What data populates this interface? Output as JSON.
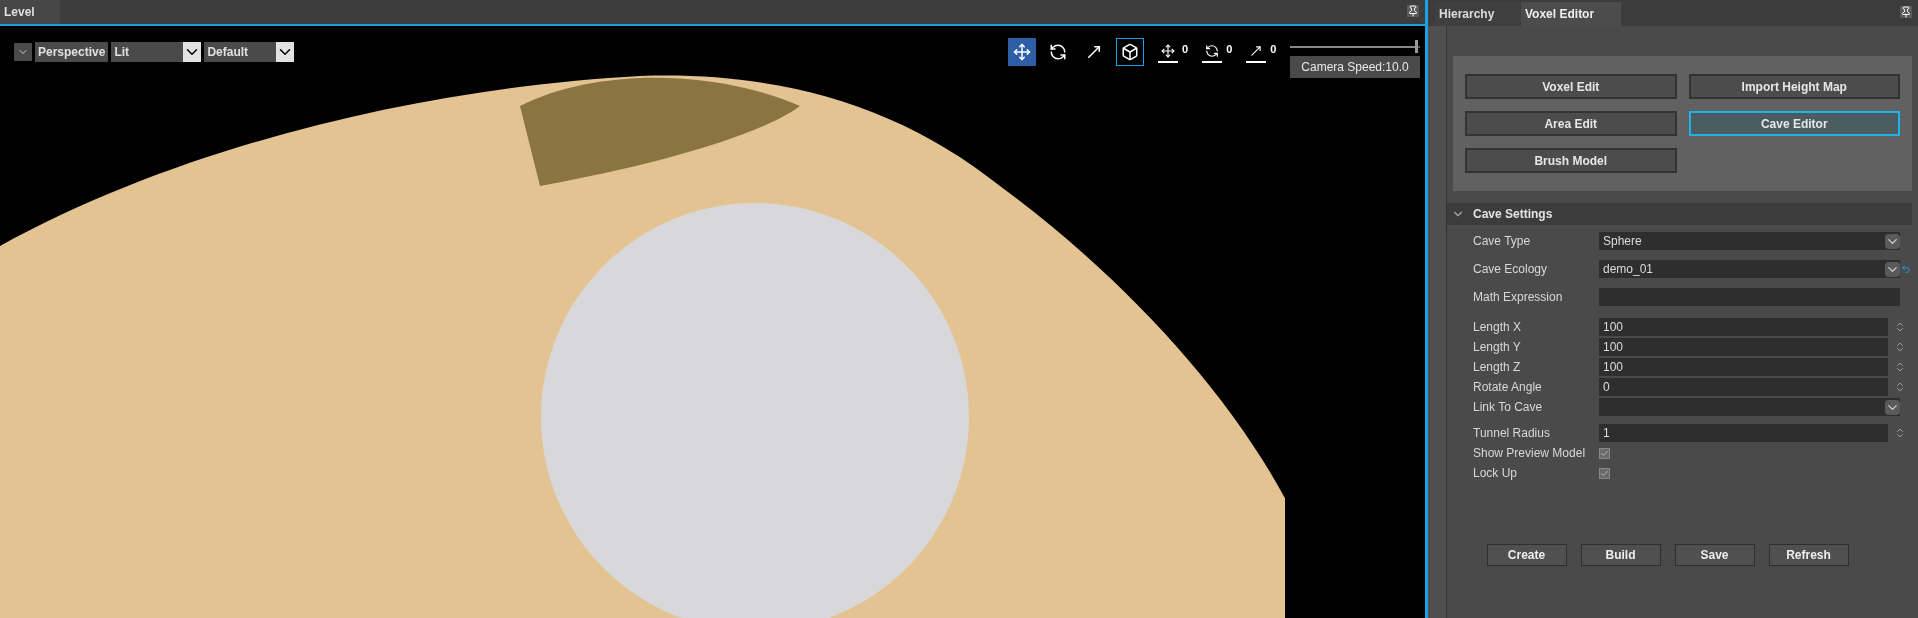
{
  "level_panel": {
    "tab": "Level",
    "toolbar": {
      "view_mode": "Perspective",
      "lighting_mode": "Lit",
      "preset": "Default"
    },
    "transform_tools": [
      {
        "kind": "move",
        "selected": true
      },
      {
        "kind": "rotate",
        "selected": false
      },
      {
        "kind": "scale",
        "selected": false
      },
      {
        "kind": "space",
        "selected": true
      }
    ],
    "snap_settings": [
      {
        "kind": "move",
        "value": "0"
      },
      {
        "kind": "rotate",
        "value": "0"
      },
      {
        "kind": "scale",
        "value": "0"
      }
    ],
    "camera_speed": {
      "level": 0.98,
      "tooltip": "Camera Speed:10.0"
    }
  },
  "side_panel": {
    "tabs": [
      {
        "label": "Hierarchy",
        "selected": false
      },
      {
        "label": "Voxel Editor",
        "selected": true
      }
    ],
    "mode_buttons": [
      {
        "label": "Voxel Edit",
        "selected": false
      },
      {
        "label": "Import Height Map",
        "selected": false
      },
      {
        "label": "Area Edit",
        "selected": false
      },
      {
        "label": "Cave Editor",
        "selected": true
      },
      {
        "label": "Brush Model",
        "selected": false
      }
    ],
    "cave_settings": {
      "title": "Cave Settings",
      "expanded": true,
      "field_groups": [
        [
          {
            "kind": "dropdown",
            "label": "Cave Type",
            "value": "Sphere",
            "reset": false
          },
          {
            "kind": "dropdown",
            "label": "Cave Ecology",
            "value": "demo_01",
            "reset": true
          },
          {
            "kind": "text",
            "label": "Math Expression"
          }
        ],
        [
          {
            "kind": "number",
            "label": "Length X",
            "value": "100"
          },
          {
            "kind": "number",
            "label": "Length Y",
            "value": "100"
          },
          {
            "kind": "number",
            "label": "Length Z",
            "value": "100"
          },
          {
            "kind": "number",
            "label": "Rotate Angle",
            "value": "0"
          },
          {
            "kind": "dropdown",
            "label": "Link To Cave",
            "reset": false
          }
        ],
        [
          {
            "kind": "number",
            "label": "Tunnel Radius",
            "value": "1"
          },
          {
            "kind": "checkbox",
            "label": "Show Preview Model",
            "checked": true
          },
          {
            "kind": "checkbox",
            "label": "Lock Up",
            "checked": true
          }
        ]
      ]
    },
    "actions": [
      "Create",
      "Build",
      "Save",
      "Refresh"
    ]
  }
}
